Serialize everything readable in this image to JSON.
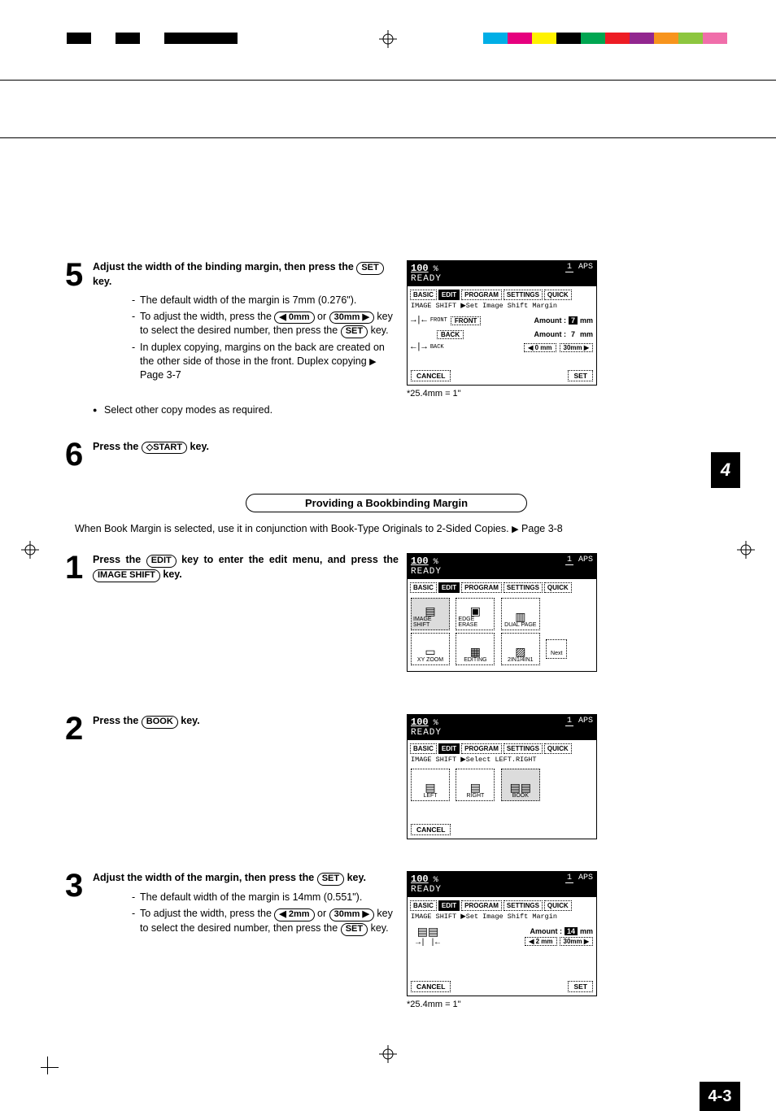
{
  "reg_colors": [
    "#00aee6",
    "#e6007e",
    "#fff200",
    "#000000",
    "#00a651",
    "#ed1c24",
    "#92278f",
    "#f7941d",
    "#8dc63f",
    "#f06eaa"
  ],
  "chapter_tab": "4",
  "page_number": "4-3",
  "conv_note": "*25.4mm = 1\"",
  "step5": {
    "title_a": "Adjust the width of the binding margin, then press the ",
    "title_key": "SET",
    "title_b": " key.",
    "b1": "The default width of the margin is 7mm (0.276\").",
    "b2a": "To adjust the width, press the ",
    "b2k1": "◀ 0mm",
    "b2mid": " or ",
    "b2k2": "30mm ▶",
    "b2b": " key to select the desired number, then press the ",
    "b2k3": "SET",
    "b2c": " key.",
    "b3a": "In duplex copying, margins on the back are created on the other side of those in the front. Duplex copying ",
    "b3ref": "Page 3-7",
    "extra": "Select other copy modes as required."
  },
  "step6": {
    "a": "Press the ",
    "key": "◇START",
    "b": " key."
  },
  "section": "Providing a Bookbinding Margin",
  "intro_a": "When Book Margin is selected, use it in conjunction with Book-Type Originals to 2-Sided Copies. ",
  "intro_ref": "Page 3-8",
  "step1": {
    "a": "Press the ",
    "k1": "EDIT",
    "b": " key to enter the edit menu, and press the ",
    "k2": "IMAGE SHIFT",
    "c": " key."
  },
  "step2": {
    "a": "Press the ",
    "k": "BOOK",
    "b": " key."
  },
  "step3": {
    "title_a": "Adjust the width of the margin, then press the ",
    "title_key": "SET",
    "title_b": " key.",
    "b1": "The default width of the margin is 14mm (0.551\").",
    "b2a": "To adjust the width, press the ",
    "b2k1": "◀ 2mm",
    "b2mid": " or ",
    "b2k2": "30mm ▶",
    "b2b": " key to select the desired number, then press the ",
    "b2k3": "SET",
    "b2c": " key."
  },
  "panel": {
    "ratio": "100",
    "pct": "%",
    "copies": "1",
    "aps": "APS",
    "ready": "READY",
    "tabs": {
      "basic": "BASIC",
      "edit": "EDIT",
      "program": "PROGRAM",
      "settings": "SETTINGS",
      "quick": "QUICK"
    },
    "sub_shift_margin": "IMAGE SHIFT  ▶Set Image Shift Margin",
    "sub_select_lrb": "IMAGE SHIFT  ▶Select LEFT.RIGHT",
    "front": "FRONT",
    "back": "BACK",
    "amount": "Amount :",
    "mm": "mm",
    "v7": "7",
    "v14": "14",
    "btn0": "◀ 0 mm",
    "btn30": "30mm ▶",
    "btn2": "◀ 2 mm",
    "cancel": "CANCEL",
    "set": "SET",
    "icons": {
      "image_shift": "IMAGE SHIFT",
      "edge_erase": "EDGE ERASE",
      "dual_page": "DUAL PAGE",
      "xy_zoom": "XY ZOOM",
      "editing": "EDITING",
      "two_four": "2IN1/4IN1",
      "next": "Next",
      "left": "LEFT",
      "right": "RIGHT",
      "book": "BOOK"
    },
    "front_lbl": "FRONT",
    "back_lbl": "BACK"
  }
}
